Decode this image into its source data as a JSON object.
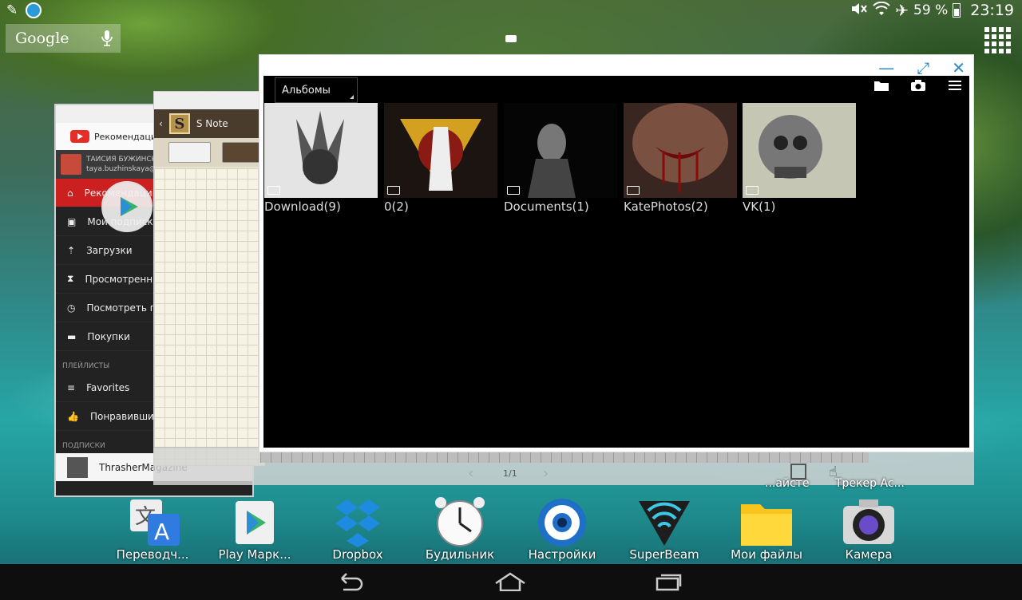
{
  "status": {
    "battery": "59 %",
    "time": "23:19"
  },
  "google": {
    "label": "Google"
  },
  "youtube": {
    "tab": "Рекомендации",
    "account_name": "ТАИСИЯ БУЖИНСКАЯ",
    "account_email": "taya.buzhinskaya@",
    "menu": [
      "Рекомендации",
      "Мои подписки",
      "Загрузки",
      "Просмотренные",
      "Посмотреть позже",
      "Покупки"
    ],
    "playlists_header": "ПЛЕЙЛИСТЫ",
    "playlists": [
      "Favorites",
      "Понравившиеся"
    ],
    "subs_header": "ПОДПИСКИ",
    "subs": [
      "ThrasherMagazine"
    ]
  },
  "snote": {
    "title": "S Note",
    "page": "1/1"
  },
  "gallery": {
    "dropdown": "Альбомы",
    "albums": [
      {
        "name": "Download(9)",
        "color": "#d9d9d9"
      },
      {
        "name": "0(2)",
        "color": "#1a1a1a"
      },
      {
        "name": "Documents(1)",
        "color": "#0a0a0a"
      },
      {
        "name": "KatePhotos(2)",
        "color": "#5a3a30"
      },
      {
        "name": "VK(1)",
        "color": "#b7b7a5"
      }
    ]
  },
  "dock_partial": [
    "...айсте",
    "Трекер Ac..."
  ],
  "dock": [
    "Переводч...",
    "Play Марк...",
    "Dropbox",
    "Будильник",
    "Настройки",
    "SuperBeam",
    "Мои файлы",
    "Камера"
  ]
}
